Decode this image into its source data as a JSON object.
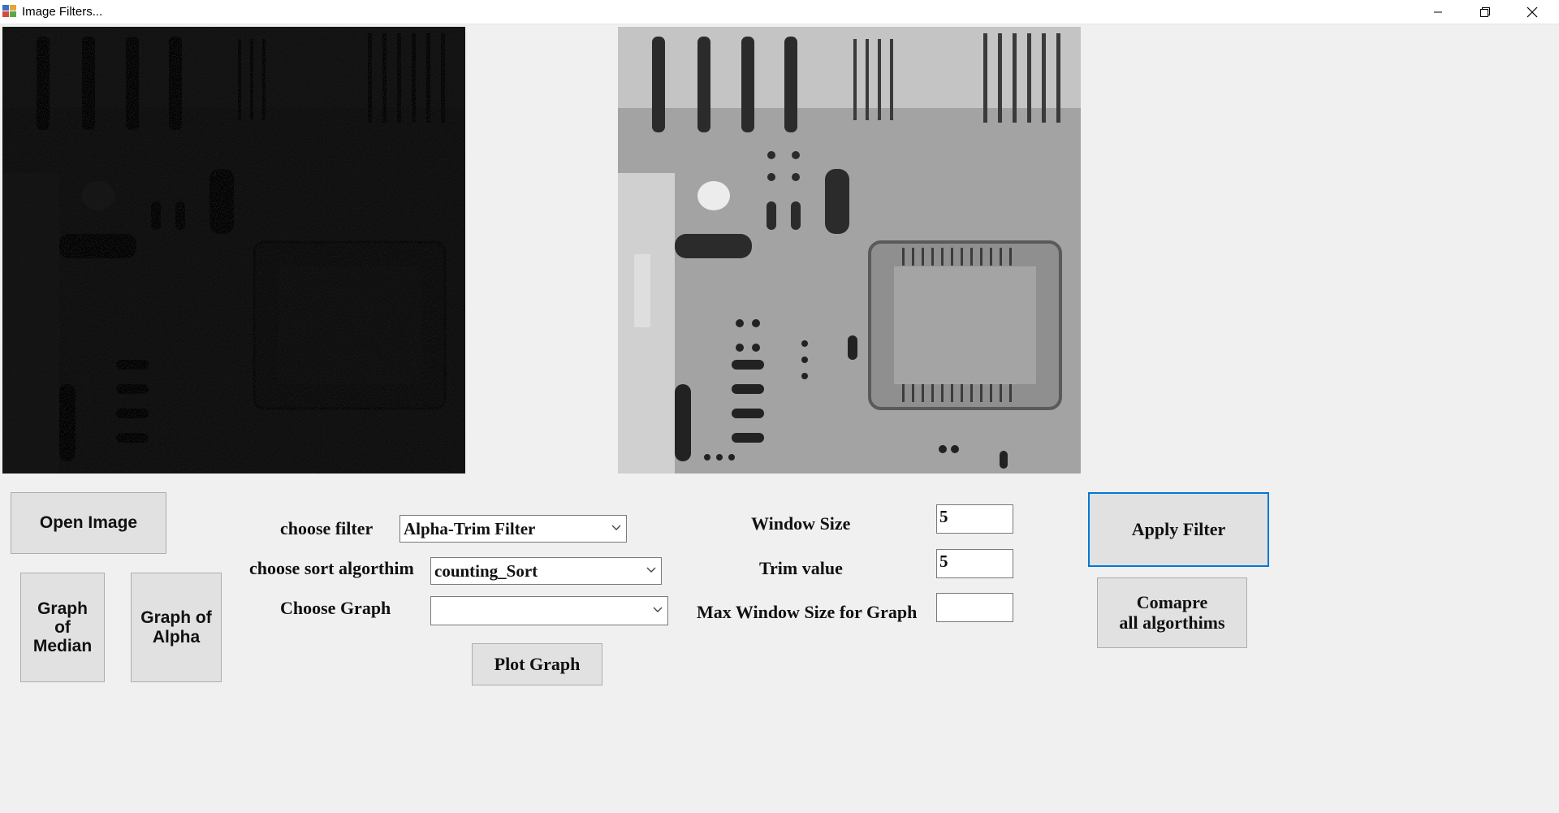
{
  "window": {
    "title": "Image Filters...",
    "icons": {
      "app": "app-icon",
      "minimize": "minimize-icon",
      "restore": "restore-icon",
      "close": "close-icon"
    }
  },
  "images": {
    "original": {
      "icon": "noisy-circuit-board-image",
      "description_visible": false
    },
    "filtered": {
      "icon": "filtered-circuit-board-image"
    }
  },
  "buttons": {
    "open_image": "Open Image",
    "graph_median_1": "Graph",
    "graph_median_2": "of",
    "graph_median_3": "Median",
    "graph_alpha_1": "Graph of",
    "graph_alpha_2": "Alpha",
    "plot_graph": "Plot Graph",
    "apply_filter": "Apply Filter",
    "compare_1": "Comapre",
    "compare_2": "all algorthims"
  },
  "labels": {
    "choose_filter": "choose filter",
    "choose_sort": "choose sort algorthim",
    "choose_graph": "Choose Graph",
    "window_size": "Window Size",
    "trim_value": "Trim value",
    "max_window": "Max Window Size for Graph"
  },
  "combos": {
    "filter": "Alpha-Trim Filter",
    "sort": "counting_Sort",
    "graph": ""
  },
  "inputs": {
    "window_size": "5",
    "trim_value": "5",
    "max_window": ""
  },
  "colors": {
    "focus_border": "#0078d7",
    "button_bg": "#e1e1e1",
    "form_bg": "#f0f0f0"
  }
}
